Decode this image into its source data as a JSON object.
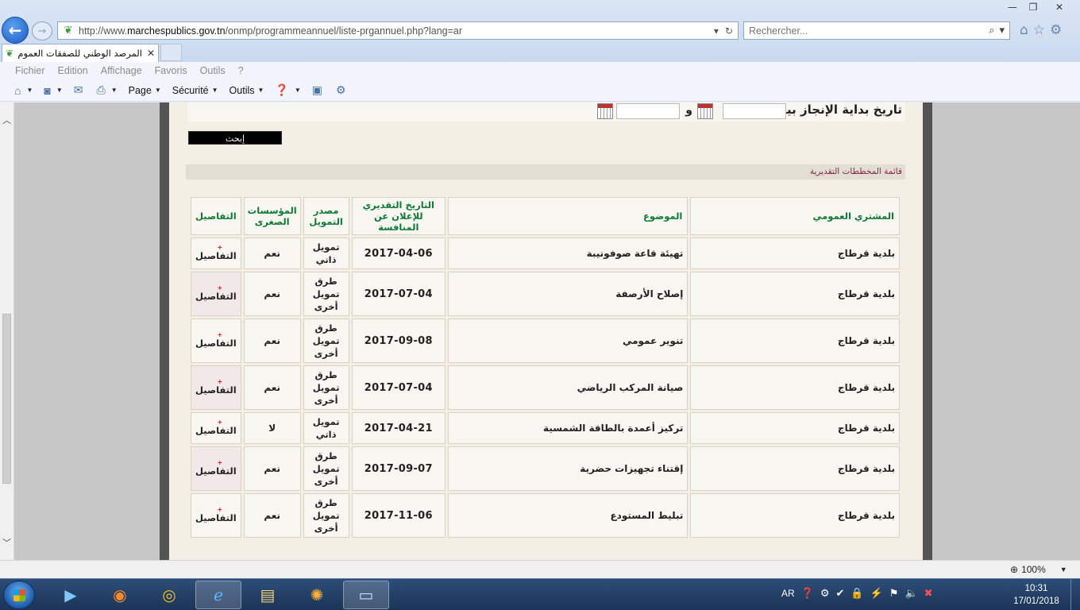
{
  "browser": {
    "url_prefix": "http://www.",
    "url_domain": "marchespublics.gov.tn",
    "url_path": "/onmp/programmeannuel/liste-prgannuel.php?lang=ar",
    "search_placeholder": "Rechercher...",
    "tab_title": "المرصد الوطني للصفقات العموم...",
    "window_controls": {
      "minimize": "—",
      "maximize": "❐",
      "close": "✕"
    }
  },
  "menu": {
    "items": [
      "Fichier",
      "Edition",
      "Affichage",
      "Favoris",
      "Outils",
      "?"
    ]
  },
  "commandbar": {
    "page": "Page",
    "security": "Sécurité",
    "tools": "Outils"
  },
  "form": {
    "date_label": "تاريخ بداية الإنجاز بين",
    "and_label": "و",
    "search_button": "إبحث"
  },
  "list": {
    "title": "قائمة المخططات التقديرية",
    "headers": {
      "buyer": "المشتري العمومي",
      "subject": "الموضوع",
      "date": "التاريخ التقديري للإعلان عن المنافسة",
      "funding": "مصدر التمويل",
      "sme": "المؤسسات الصغرى",
      "details": "التفاصيل"
    },
    "rows": [
      {
        "buyer": "بلدية قرطاج",
        "subject": "تهيئة قاعة صوفونيبة",
        "date": "2017-04-06",
        "funding": "تمويل ذاتي",
        "sme": "نعم",
        "details": "التفاصيل"
      },
      {
        "buyer": "بلدية قرطاج",
        "subject": "إصلاح الأرصفة",
        "date": "2017-07-04",
        "funding": "طرق تمويل أخرى",
        "sme": "نعم",
        "details": "التفاصيل"
      },
      {
        "buyer": "بلدية قرطاج",
        "subject": "تنوير عمومي",
        "date": "2017-09-08",
        "funding": "طرق تمويل أخرى",
        "sme": "نعم",
        "details": "التفاصيل"
      },
      {
        "buyer": "بلدية قرطاج",
        "subject": "صيانة المركب الرياضي",
        "date": "2017-07-04",
        "funding": "طرق تمويل أخرى",
        "sme": "نعم",
        "details": "التفاصيل"
      },
      {
        "buyer": "بلدية قرطاج",
        "subject": "تركيز أعمدة بالطاقة الشمسية",
        "date": "2017-04-21",
        "funding": "تمويل ذاتي",
        "sme": "لا",
        "details": "التفاصيل"
      },
      {
        "buyer": "بلدية قرطاج",
        "subject": "إقتناء تجهيزات حضرية",
        "date": "2017-09-07",
        "funding": "طرق تمويل أخرى",
        "sme": "نعم",
        "details": "التفاصيل"
      },
      {
        "buyer": "بلدية قرطاج",
        "subject": "تبليط المستودع",
        "date": "2017-11-06",
        "funding": "طرق تمويل أخرى",
        "sme": "نعم",
        "details": "التفاصيل"
      }
    ]
  },
  "status": {
    "zoom": "100%"
  },
  "taskbar": {
    "lang": "AR",
    "time": "10:31",
    "date": "17/01/2018"
  },
  "icons": {
    "back": "back-arrow-icon",
    "forward": "forward-arrow-icon",
    "home": "home-icon",
    "favorites": "star-icon",
    "settings": "gear-icon"
  }
}
